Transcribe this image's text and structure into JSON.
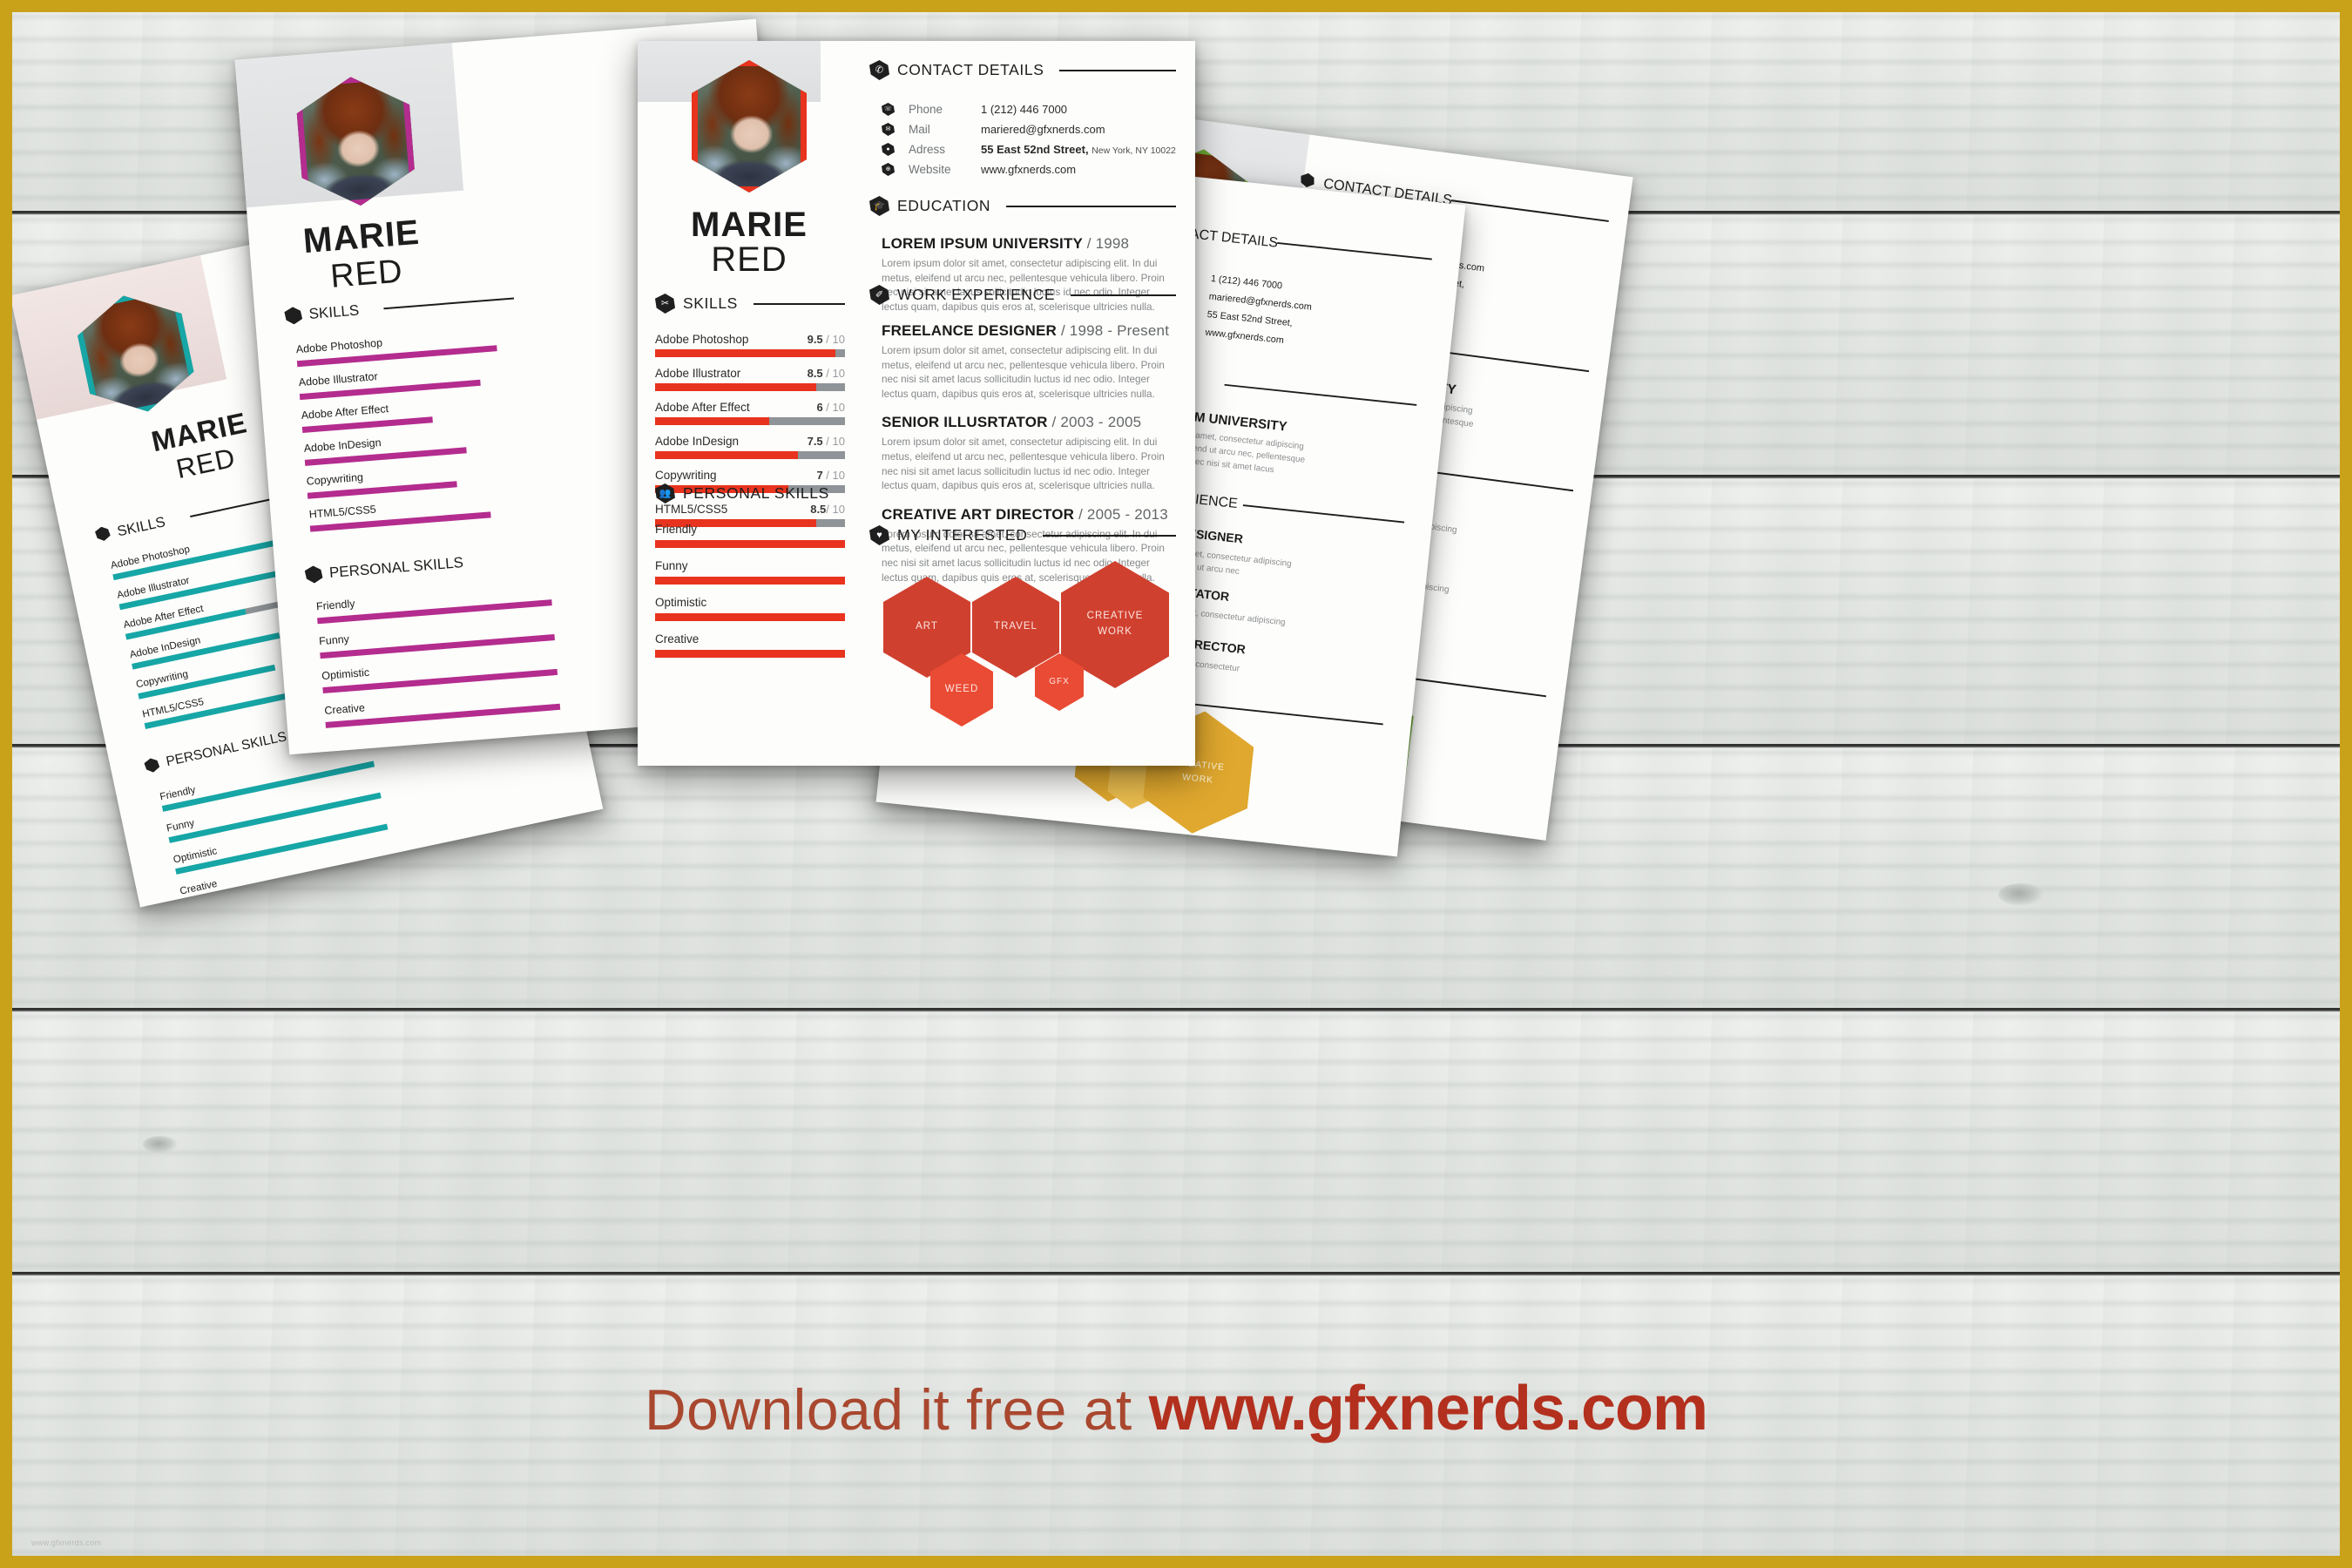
{
  "banner": {
    "prefix": "Download it free at ",
    "site": "www.gfxnerds.com",
    "watermark": "www.gfxnerds.com"
  },
  "person": {
    "first_name": "MARIE",
    "last_name": "RED"
  },
  "sections": {
    "contact": "CONTACT DETAILS",
    "education": "EDUCATION",
    "work": "WORK EXPERIENCE",
    "skills": "SKILLS",
    "personal_skills": "PERSONAL SKILLS",
    "interests": "MY INTERESTED"
  },
  "contact": {
    "rows": [
      {
        "icon": "phone-icon",
        "label": "Phone",
        "value": "1 (212) 446 7000",
        "extra": ""
      },
      {
        "icon": "mail-icon",
        "label": "Mail",
        "value": "mariered@gfxnerds.com",
        "extra": ""
      },
      {
        "icon": "location-pin-icon",
        "label": "Adress",
        "value": "55 East 52nd Street,",
        "extra": "New York, NY 10022"
      },
      {
        "icon": "globe-icon",
        "label": "Website",
        "value": "www.gfxnerds.com",
        "extra": ""
      }
    ]
  },
  "lorem": "Lorem ipsum dolor sit amet, consectetur adipiscing elit. In dui metus, eleifend ut arcu nec, pellentesque vehicula libero. Proin nec nisi sit amet lacus sollicitudin luctus id nec odio. Integer lectus quam, dapibus quis eros at, scelerisque ultricies nulla.",
  "education": [
    {
      "title": "LOREM IPSUM UNIVERSITY",
      "meta": "/ 1998"
    }
  ],
  "work": [
    {
      "title": "FREELANCE DESIGNER",
      "meta": "/ 1998 - Present"
    },
    {
      "title": "SENIOR ILLUSRTATOR",
      "meta": "/ 2003 - 2005"
    },
    {
      "title": "CREATIVE ART DIRECTOR",
      "meta": "/ 2005 - 2013"
    }
  ],
  "skills": {
    "max": "10",
    "items": [
      {
        "name": "Adobe Photoshop",
        "score": "9.5",
        "pct": 95
      },
      {
        "name": "Adobe Illustrator",
        "score": "8.5",
        "pct": 85
      },
      {
        "name": "Adobe After Effect",
        "score": "6",
        "pct": 60
      },
      {
        "name": "Adobe InDesign",
        "score": "7.5",
        "pct": 75
      },
      {
        "name": "Copywriting",
        "score": "7",
        "pct": 70
      },
      {
        "name": "HTML5/CSS5",
        "score": "8.5",
        "pct": 85
      }
    ]
  },
  "personal_skills": [
    {
      "name": "Friendly"
    },
    {
      "name": "Funny"
    },
    {
      "name": "Optimistic"
    },
    {
      "name": "Creative"
    }
  ],
  "interests": [
    {
      "label": "ART",
      "size": "large"
    },
    {
      "label": "TRAVEL",
      "size": "large"
    },
    {
      "label": "CREATIVE WORK",
      "size": "large"
    },
    {
      "label": "WEED",
      "size": "small"
    },
    {
      "label": "GFX",
      "size": "small"
    }
  ],
  "interest_labels": {
    "art": "ART",
    "travel": "TRAVEL",
    "creative": "CREATIVE",
    "work": "WORK",
    "weed": "WEED",
    "gfx": "GFX"
  },
  "colors": {
    "red_accent": "#E8331E",
    "red_hex_large": "#D0402F",
    "red_hex_small": "#EA4B34",
    "teal_accent": "#17A6A6",
    "magenta_accent": "#B32C8E",
    "yellow_accent": "#E0A82E",
    "green_accent": "#6CA933",
    "bar_track": "#8E9497",
    "banner_text": "#A9472F",
    "banner_site": "#B3301E",
    "frame": "#C9A21A"
  },
  "variants": [
    {
      "name": "teal-resume",
      "accent": "#17A6A6",
      "secondary": "#B32C8E"
    },
    {
      "name": "magenta-resume",
      "accent": "#B32C8E",
      "secondary": "#B32C8E"
    },
    {
      "name": "red-resume",
      "accent": "#E8331E",
      "secondary": "#D0402F"
    },
    {
      "name": "yellow-resume",
      "accent": "#E0A82E",
      "secondary": "#E0A82E"
    },
    {
      "name": "green-resume",
      "accent": "#6CA933",
      "secondary": "#6CA933"
    }
  ]
}
